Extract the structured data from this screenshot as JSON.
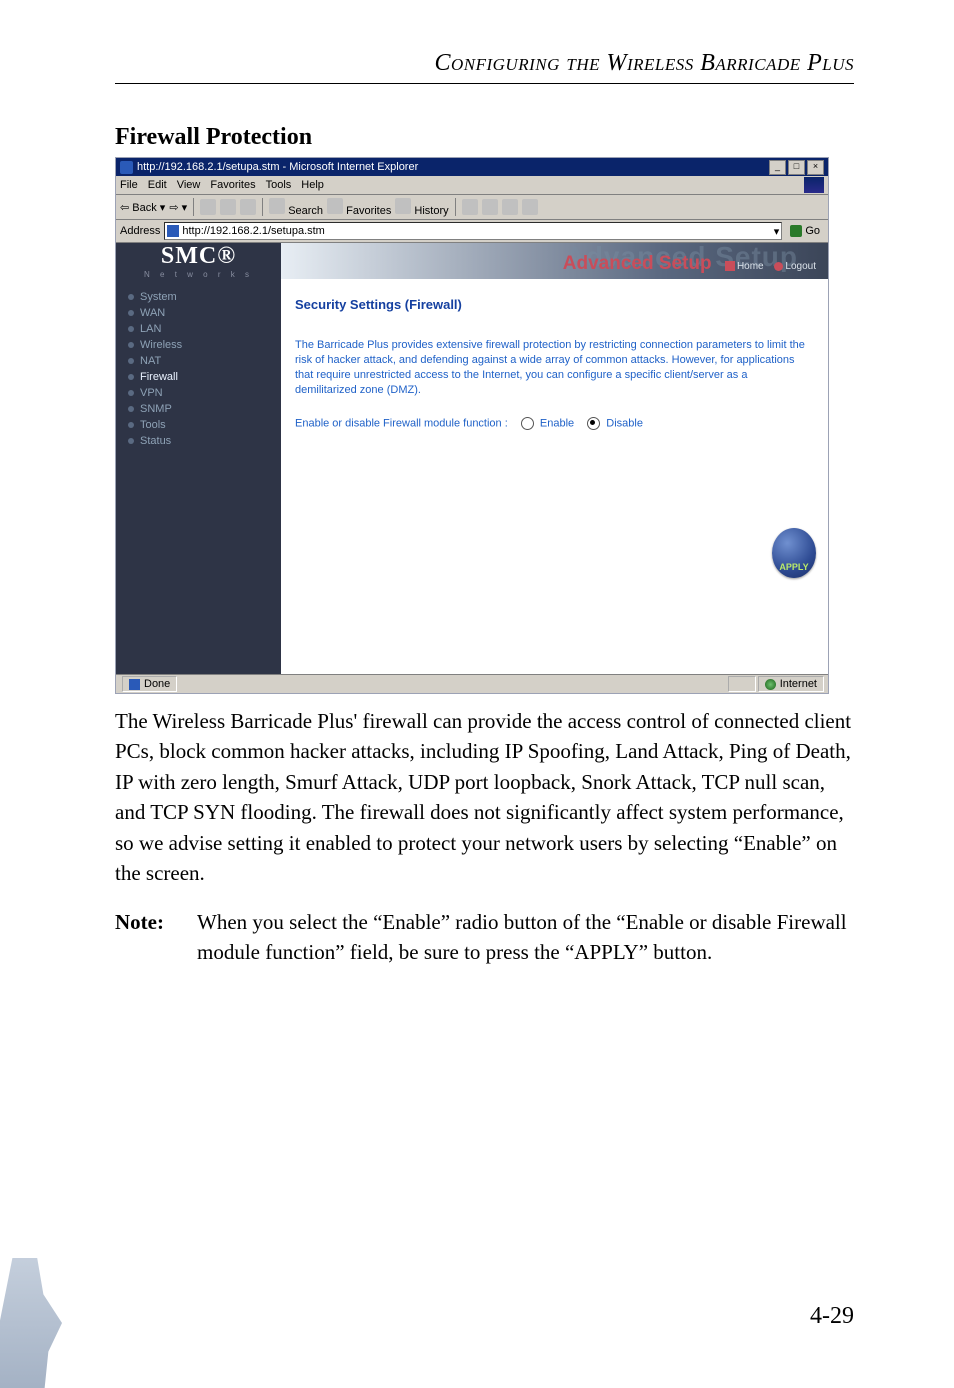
{
  "header": {
    "title": "Configuring the Wireless Barricade Plus"
  },
  "section": {
    "heading": "Firewall Protection"
  },
  "screenshot": {
    "window_title": "http://192.168.2.1/setupa.stm - Microsoft Internet Explorer",
    "menus": [
      "File",
      "Edit",
      "View",
      "Favorites",
      "Tools",
      "Help"
    ],
    "toolbar": {
      "back": "Back",
      "search": "Search",
      "favorites": "Favorites",
      "history": "History"
    },
    "addressbar": {
      "label": "Address",
      "url": "http://192.168.2.1/setupa.stm",
      "go": "Go"
    },
    "brand": {
      "logo": "SMC®",
      "sub": "N e t w o r k s"
    },
    "banner": {
      "ghost": "Advanced Setup",
      "title": "Advanced Setup",
      "home": "Home",
      "logout": "Logout"
    },
    "sidebar": [
      "System",
      "WAN",
      "LAN",
      "Wireless",
      "NAT",
      "Firewall",
      "VPN",
      "SNMP",
      "Tools",
      "Status"
    ],
    "panel": {
      "title": "Security Settings (Firewall)",
      "description": "The Barricade Plus provides extensive firewall protection by restricting connection parameters to limit the risk of hacker attack, and defending against a wide array of common attacks. However, for applications that require unrestricted access to the Internet, you can configure a specific client/server as a demilitarized zone (DMZ).",
      "radio_label": "Enable or disable Firewall module function :",
      "enable": "Enable",
      "disable": "Disable",
      "apply": "APPLY"
    },
    "status": {
      "left": "Done",
      "zone": "Internet"
    }
  },
  "body": {
    "paragraph": "The Wireless Barricade Plus' firewall can provide the access control of connected client PCs, block common hacker attacks, including IP Spoofing, Land Attack, Ping of Death, IP with zero length, Smurf Attack, UDP port loopback, Snork Attack, TCP null scan, and TCP SYN flooding. The firewall does not significantly affect system performance, so we advise setting it enabled to protect your network users by selecting “Enable” on the screen.",
    "note_label": "Note:",
    "note_text": "When you select the “Enable” radio button of the “Enable or disable Firewall module function” field, be sure to press the “APPLY” button."
  },
  "footer": {
    "page": "4-29"
  }
}
